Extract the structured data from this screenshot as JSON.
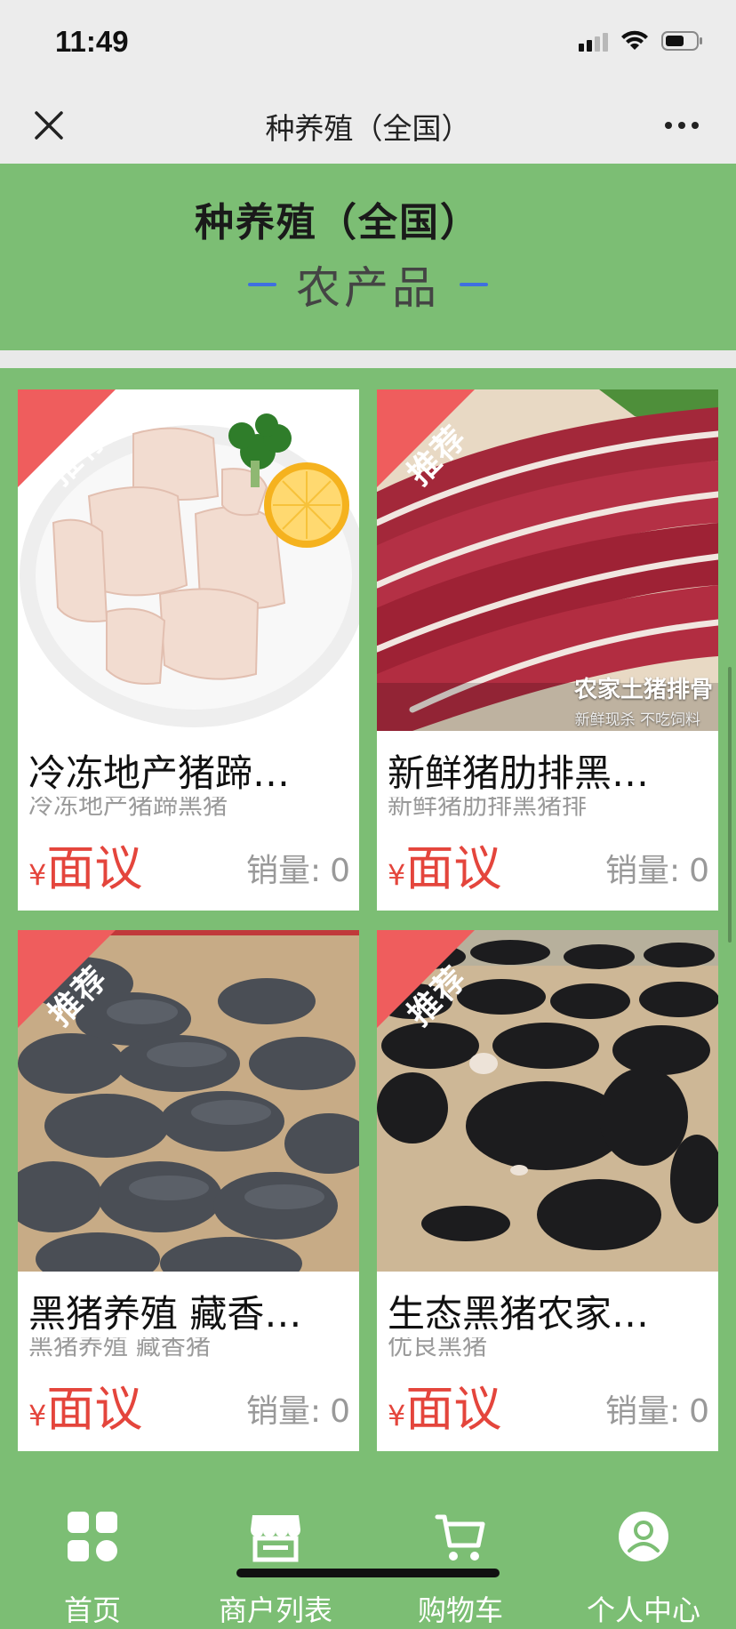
{
  "status": {
    "time": "11:49"
  },
  "nav": {
    "title": "种养殖（全国）"
  },
  "banner": {
    "title": "种养殖（全国）",
    "subtitle": "农产品"
  },
  "products": [
    {
      "badge": "推荐",
      "name": "冷冻地产猪蹄…",
      "desc": "冷冻地产猪蹄黑猪",
      "price_symbol": "¥",
      "price": "面议",
      "sales_label": "销量:",
      "sales": "0"
    },
    {
      "badge": "推荐",
      "name": "新鲜猪肋排黑…",
      "desc": "新鲜猪肋排黑猪排",
      "price_symbol": "¥",
      "price": "面议",
      "sales_label": "销量:",
      "sales": "0",
      "image_caption": "农家土猪排骨",
      "image_caption_small": "新鲜现杀  不吃饲料"
    },
    {
      "badge": "推荐",
      "name": "黑猪养殖 藏香…",
      "desc": "黑猪养殖 藏香猪",
      "price_symbol": "¥",
      "price": "面议",
      "sales_label": "销量:",
      "sales": "0"
    },
    {
      "badge": "推荐",
      "name": "生态黑猪农家…",
      "desc": "优良黑猪",
      "price_symbol": "¥",
      "price": "面议",
      "sales_label": "销量:",
      "sales": "0"
    }
  ],
  "tabbar": {
    "items": [
      {
        "label": "首页",
        "icon": "grid-icon"
      },
      {
        "label": "商户列表",
        "icon": "store-icon"
      },
      {
        "label": "购物车",
        "icon": "cart-icon"
      },
      {
        "label": "个人中心",
        "icon": "user-icon"
      }
    ]
  },
  "colors": {
    "theme_green": "#7cbe74",
    "ribbon_red": "#ef5d5d",
    "price_red": "#e4453c",
    "dash_blue": "#3f6fe0"
  }
}
